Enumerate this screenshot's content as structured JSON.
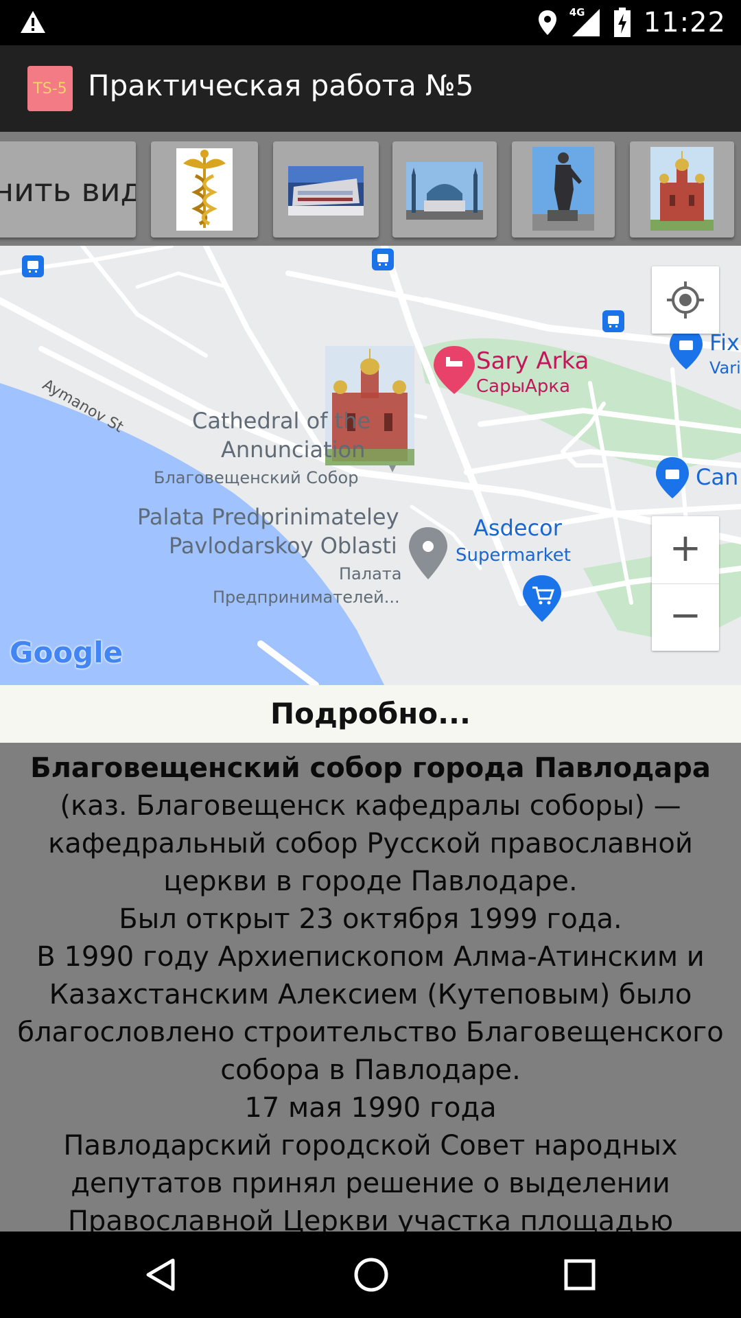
{
  "status_bar": {
    "network": "4G",
    "time": "11:22"
  },
  "app_bar": {
    "icon_label": "TS-5",
    "title": "Практическая работа №5"
  },
  "toolbar": {
    "view_button_label": "нить вид",
    "thumbnails": [
      "caduceus-emblem",
      "building-photo",
      "mosque-photo",
      "statue-photo",
      "cathedral-photo"
    ]
  },
  "map": {
    "street_label": "Aymanov St",
    "sary_arka_en": "Sary Arka",
    "sary_arka_ru": "СарыАрка",
    "fix_label": "Fix",
    "fix_sub": "Vari",
    "can_label": "Can",
    "cathedral_en_line1": "Cathedral of the",
    "cathedral_en_line2": "Annunciation",
    "cathedral_ru": "Благовещенский Собор",
    "palata_en_line1": "Palata Predprinimateley",
    "palata_en_line2": "Pavlodarskoy Oblasti",
    "palata_ru_line1": "Палата",
    "palata_ru_line2": "Предпринимателей...",
    "asdecor": "Asdecor",
    "supermarket": "Supermarket",
    "google_logo": "Google",
    "zoom_in": "+",
    "zoom_out": "−"
  },
  "details": {
    "header": "Подробно...",
    "lead": "Благовещенский собор города Павлодара",
    "body": " (каз. Благовещенск кафедралы соборы) — кафедральный собор Русской православной церкви в городе Павлодаре.\nБыл открыт 23 октября 1999 года.\nВ 1990 году Архиепископом Алма-Атинским и Казахстанским Алексием (Кутеповым) было благословлено строительство Благовещенского собора в Павлодаре.\n17 мая 1990 года\nПавлодарский городской Совет народных депутатов принял решение о выделении Православной Церкви участка площадью"
  },
  "colors": {
    "app_bar": "#212121",
    "map_water": "#a0c3ff",
    "map_park": "#c8e6c9",
    "poi_pink": "#e8426b",
    "poi_blue": "#1a73e8",
    "details_bg": "#7f7f7f"
  }
}
